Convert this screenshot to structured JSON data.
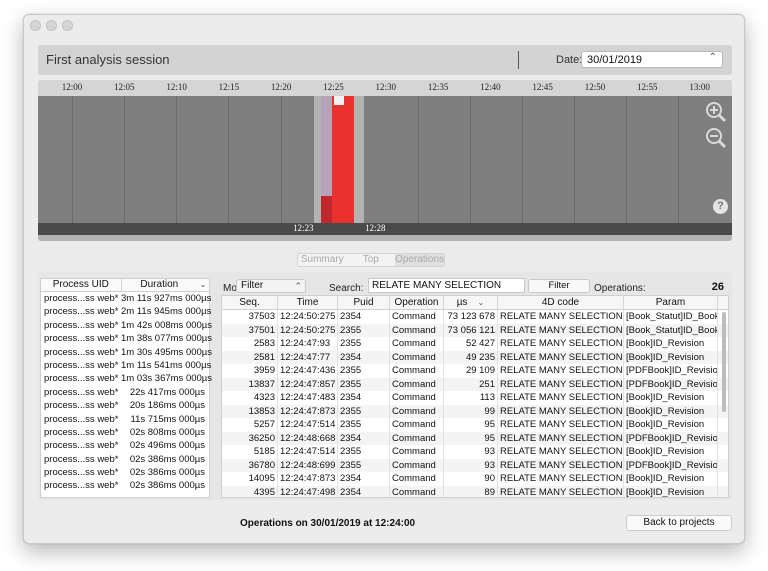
{
  "header": {
    "session_title": "First analysis session",
    "date_label": "Date:",
    "date_value": "30/01/2019"
  },
  "timeline": {
    "hours": [
      "12:00",
      "12:05",
      "12:10",
      "12:15",
      "12:20",
      "12:25",
      "12:30",
      "12:35",
      "12:40",
      "12:45",
      "12:50",
      "12:55",
      "13:00"
    ],
    "strip_left_label": "12:23",
    "strip_right_label": "12:28",
    "colors": {
      "active": "#e8322b",
      "active_dark": "#c0282d",
      "mauve": "#b6a2b8",
      "block": "#7f7f7f"
    }
  },
  "tabs": [
    "Summary",
    "Top",
    "Operations"
  ],
  "process_table": {
    "headers": [
      "Process UID",
      "Duration"
    ],
    "rows": [
      [
        "process...ss web*",
        "3m 11s 927ms 000µs"
      ],
      [
        "process...ss web*",
        "2m 11s 945ms 000µs"
      ],
      [
        "process...ss web*",
        "1m 42s 008ms 000µs"
      ],
      [
        "process...ss web*",
        "1m 38s 077ms 000µs"
      ],
      [
        "process...ss web*",
        "1m 30s 495ms 000µs"
      ],
      [
        "process...ss web*",
        "1m 11s 541ms 000µs"
      ],
      [
        "process...ss web*",
        "1m 03s 367ms 000µs"
      ],
      [
        "process...ss web*",
        "22s 417ms 000µs"
      ],
      [
        "process...ss web*",
        "20s 186ms 000µs"
      ],
      [
        "process...ss web*",
        "11s 715ms 000µs"
      ],
      [
        "process...ss web*",
        "02s 808ms 000µs"
      ],
      [
        "process...ss web*",
        "02s 496ms 000µs"
      ],
      [
        "process...ss web*",
        "02s 386ms 000µs"
      ],
      [
        "process...ss web*",
        "02s 386ms 000µs"
      ],
      [
        "process...ss web*",
        "02s 386ms 000µs"
      ]
    ]
  },
  "toolbar": {
    "mode_label": "Mode:",
    "mode_value": "Filter",
    "search_label": "Search:",
    "search_value": "RELATE MANY SELECTION",
    "filter_button": "Filter",
    "operations_label": "Operations:",
    "operations_count": "26"
  },
  "operations_table": {
    "headers": [
      "Seq.",
      "Time",
      "Puid",
      "Operation",
      "µs",
      "4D code",
      "Param"
    ],
    "rows": [
      [
        "37503",
        "12:24:50:275",
        "2354",
        "Command",
        "73 123 678",
        "RELATE MANY SELECTION",
        "[Book_Statut]ID_Book"
      ],
      [
        "37501",
        "12:24:50:275",
        "2355",
        "Command",
        "73 056 121",
        "RELATE MANY SELECTION",
        "[Book_Statut]ID_Book"
      ],
      [
        "2583",
        "12:24:47:93",
        "2355",
        "Command",
        "52 427",
        "RELATE MANY SELECTION",
        "[Book]ID_Revision"
      ],
      [
        "2581",
        "12:24:47:77",
        "2354",
        "Command",
        "49 235",
        "RELATE MANY SELECTION",
        "[Book]ID_Revision"
      ],
      [
        "3959",
        "12:24:47:436",
        "2355",
        "Command",
        "29 109",
        "RELATE MANY SELECTION",
        "[PDFBook]ID_Revision"
      ],
      [
        "13837",
        "12:24:47:857",
        "2355",
        "Command",
        "251",
        "RELATE MANY SELECTION",
        "[PDFBook]ID_Revision"
      ],
      [
        "4323",
        "12:24:47:483",
        "2354",
        "Command",
        "113",
        "RELATE MANY SELECTION",
        "[Book]ID_Revision"
      ],
      [
        "13853",
        "12:24:47:873",
        "2355",
        "Command",
        "99",
        "RELATE MANY SELECTION",
        "[Book]ID_Revision"
      ],
      [
        "5257",
        "12:24:47:514",
        "2355",
        "Command",
        "95",
        "RELATE MANY SELECTION",
        "[Book]ID_Revision"
      ],
      [
        "36250",
        "12:24:48:668",
        "2354",
        "Command",
        "95",
        "RELATE MANY SELECTION",
        "[PDFBook]ID_Revision"
      ],
      [
        "5185",
        "12:24:47:514",
        "2355",
        "Command",
        "93",
        "RELATE MANY SELECTION",
        "[Book]ID_Revision"
      ],
      [
        "36780",
        "12:24:48:699",
        "2355",
        "Command",
        "93",
        "RELATE MANY SELECTION",
        "[PDFBook]ID_Revision"
      ],
      [
        "14095",
        "12:24:47:873",
        "2354",
        "Command",
        "90",
        "RELATE MANY SELECTION",
        "[Book]ID_Revision"
      ],
      [
        "4395",
        "12:24:47:498",
        "2354",
        "Command",
        "89",
        "RELATE MANY SELECTION",
        "[Book]ID_Revision"
      ]
    ]
  },
  "footer": {
    "status": "Operations on 30/01/2019 at 12:24:00",
    "back_button": "Back to projects"
  }
}
